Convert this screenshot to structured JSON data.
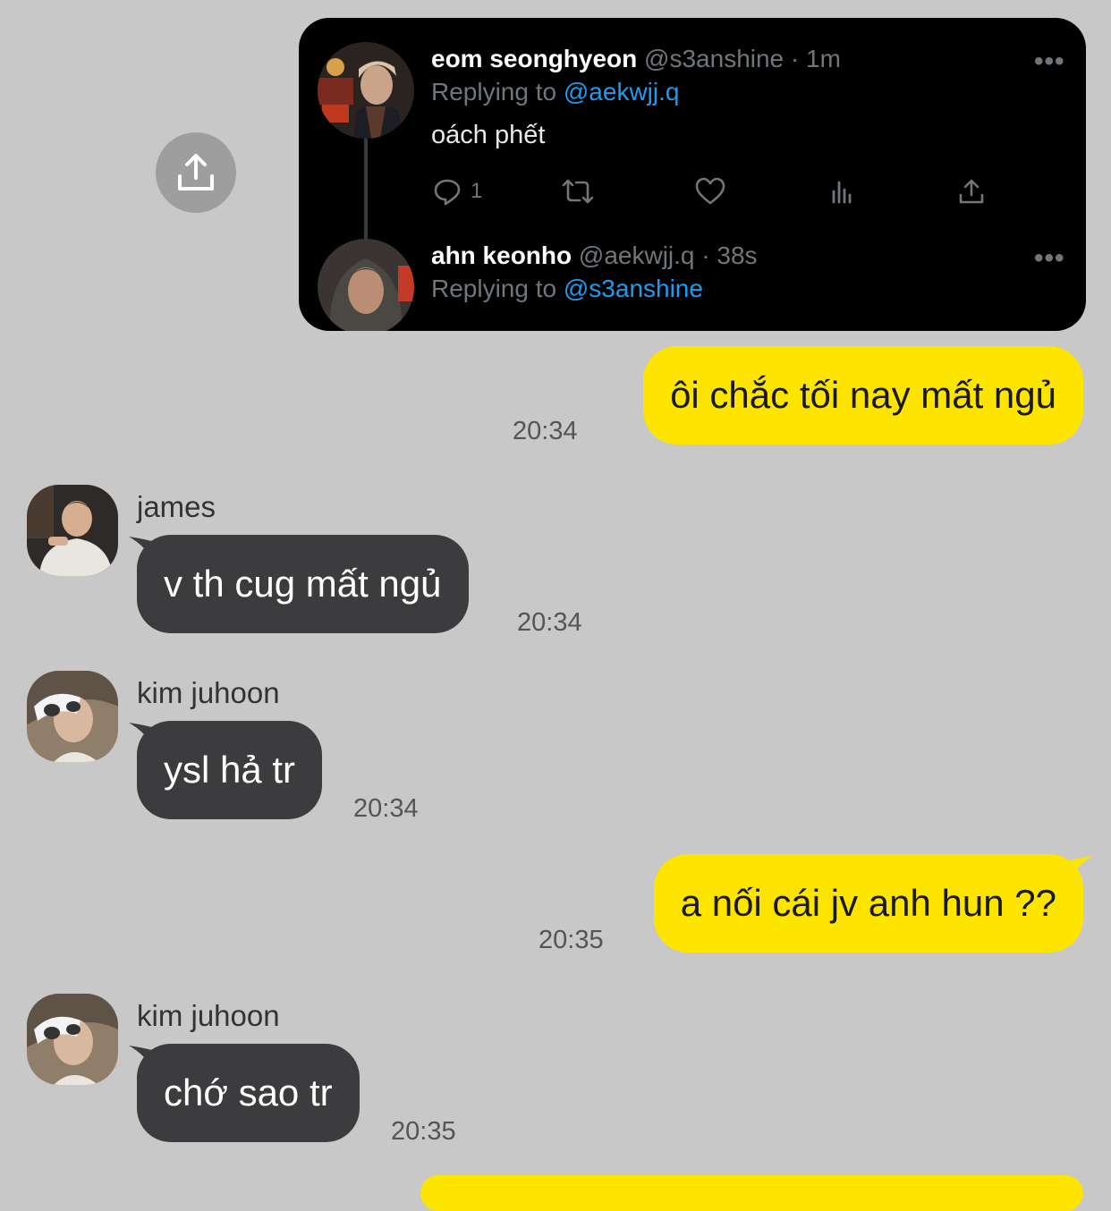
{
  "tweet": {
    "first": {
      "name": "eom seonghyeon",
      "handle_time": "@s3anshine · 1m",
      "replying_prefix": "Replying to",
      "replying_handle": "@aekwjj.q",
      "text": "oách phết",
      "reply_count": "1"
    },
    "second": {
      "name": "ahn keonho",
      "handle_time": "@aekwjj.q · 38s",
      "replying_prefix": "Replying to",
      "replying_handle": "@s3anshine"
    },
    "more_label": "•••"
  },
  "messages": [
    {
      "text": "ôi chắc tối nay mất ngủ",
      "time": "20:34"
    },
    {
      "sender": "james",
      "text": "v th cug mất ngủ",
      "time": "20:34"
    },
    {
      "sender": "kim juhoon",
      "text": "ysl hả tr",
      "time": "20:34"
    },
    {
      "text": "a nối cái jv anh hun ??",
      "time": "20:35"
    },
    {
      "sender": "kim juhoon",
      "text": "chớ sao tr",
      "time": "20:35"
    }
  ],
  "colors": {
    "background": "#c8c8c8",
    "my_bubble": "#fee500",
    "their_bubble": "#3c3c3e",
    "twitter_link": "#1d9bf0"
  }
}
